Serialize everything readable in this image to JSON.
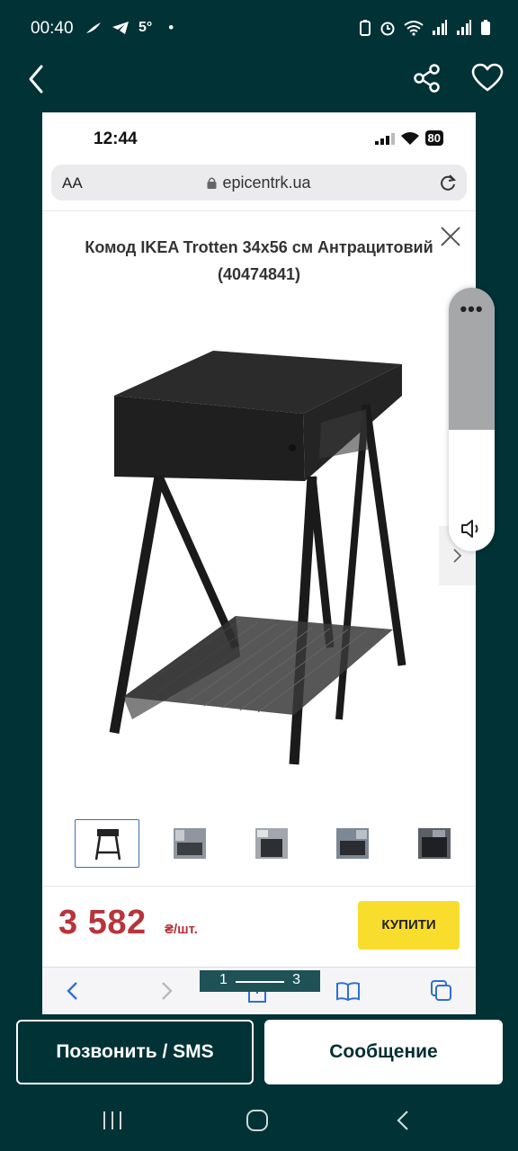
{
  "status_bar": {
    "time": "00:40",
    "temperature": "5°",
    "dot": "•",
    "icons": [
      "feather-icon",
      "telegram-icon",
      "alarm-icon",
      "wifi-icon",
      "signal-icon",
      "battery-icon"
    ]
  },
  "screenshot": {
    "ios_time": "12:44",
    "ios_battery": "80",
    "url_aa": "AA",
    "url": "epicentrk.ua",
    "product_title": "Комод IKEA Trotten 34x56 см Антрацитовий (40474841)",
    "thumbnail_count": 5,
    "active_thumbnail": 1,
    "price": "3 582",
    "price_unit": "₴/шт.",
    "buy_label": "КУПИТИ",
    "page_indicator": {
      "current": "1",
      "total": "3"
    }
  },
  "volume_panel": {
    "dots": "•••",
    "level": 0.54
  },
  "actions": {
    "call_label": "Позвонить / SMS",
    "message_label": "Сообщение"
  },
  "colors": {
    "background": "#003236",
    "price": "#b8343a",
    "buy_button": "#f9dd2d"
  }
}
